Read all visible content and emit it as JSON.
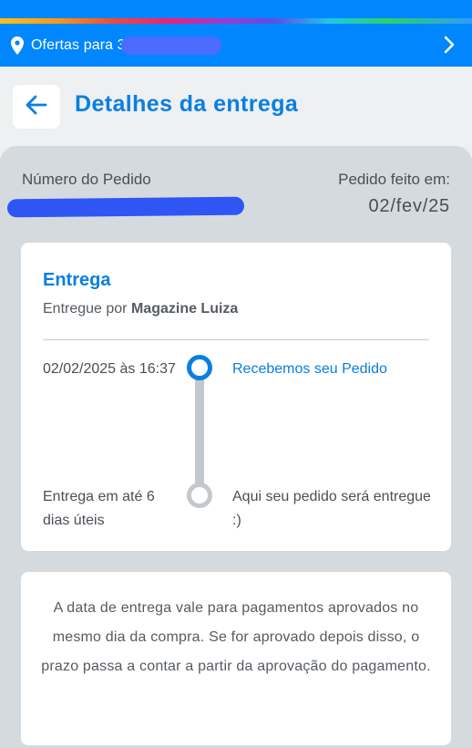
{
  "location_bar": {
    "text": "Ofertas para 3",
    "icon": "location-pin-icon",
    "chevron_icon": "chevron-right-icon"
  },
  "header": {
    "title": "Detalhes da entrega",
    "back_icon": "arrow-left-icon"
  },
  "order": {
    "number_label": "Número do Pedido",
    "placed_label": "Pedido feito em:",
    "placed_date": "02/fev/25"
  },
  "delivery": {
    "title": "Entrega",
    "delivered_by_prefix": "Entregue por",
    "seller": "Magazine Luiza",
    "steps": [
      {
        "date": "02/02/2025 às 16:37",
        "status": "Recebemos seu Pedido",
        "active": true
      },
      {
        "date": "Entrega em até 6 dias úteis",
        "status": "Aqui seu pedido será entregue :)",
        "active": false
      }
    ]
  },
  "info": {
    "text": "A data de entrega vale para pagamentos aprovados no mesmo dia da compra. Se for aprovado depois disso, o prazo passa a contar a partir da aprovação do pagamento."
  },
  "colors": {
    "brand_blue": "#0086ff",
    "accent_blue": "#0a7fe0",
    "panel_gray": "#d5dade"
  }
}
